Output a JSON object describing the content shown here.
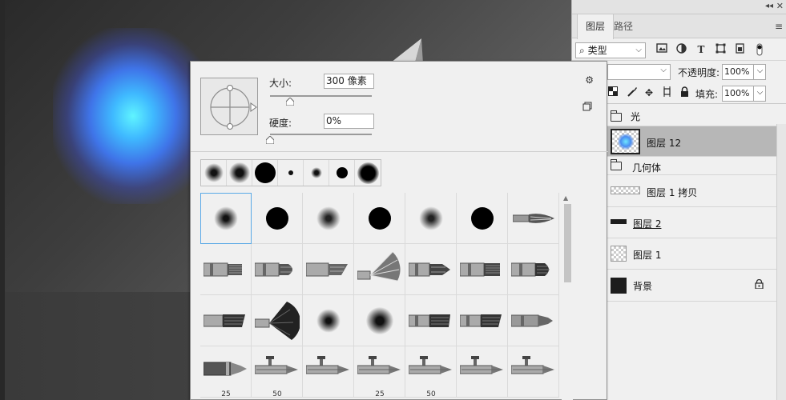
{
  "layers_panel": {
    "collapse_glyph": "◂◂",
    "close_glyph": "✕",
    "tabs": [
      "图层",
      "路径"
    ],
    "menu_glyph": "≡",
    "filter": {
      "kind": "类型",
      "search_glyph": "⌕"
    },
    "blend_mode": "",
    "opacity_label": "不透明度:",
    "opacity_value": "100%",
    "fill_label": "填充:",
    "fill_value": "100%",
    "layers": [
      {
        "name": "光",
        "type": "group"
      },
      {
        "name": "图层 12",
        "type": "layer",
        "selected": true
      },
      {
        "name": "几何体",
        "type": "group"
      },
      {
        "name": "图层 1 拷贝",
        "type": "layer"
      },
      {
        "name": "图层 2",
        "type": "layer",
        "underlined": true
      },
      {
        "name": "图层 1",
        "type": "layer"
      },
      {
        "name": "背景",
        "type": "background",
        "locked": true
      }
    ],
    "icons": {
      "filter": [
        "image-filter-icon",
        "adjustment-filter-icon",
        "type-filter-icon",
        "shape-filter-icon",
        "smart-object-filter-icon",
        "filter-toggle-icon"
      ],
      "lock": [
        "lock-transparent-icon",
        "lock-image-icon",
        "lock-position-icon",
        "lock-artboard-icon",
        "lock-all-icon"
      ]
    }
  },
  "brush_popup": {
    "size_label": "大小:",
    "size_value": "300 像素",
    "size_level": 0.2,
    "hardness_label": "硬度:",
    "hardness_value": "0%",
    "hardness_level": 0.0,
    "gear_glyph": "⚙",
    "presets_size_labels": [
      "25",
      "50",
      "",
      "25",
      "50",
      "",
      ""
    ]
  },
  "colors": {
    "accent_selection": "#5aa9e6",
    "selected_layer": "#b7b7b7",
    "glow_center": "#5ff4ff",
    "glow_outer": "#3f74e8"
  }
}
